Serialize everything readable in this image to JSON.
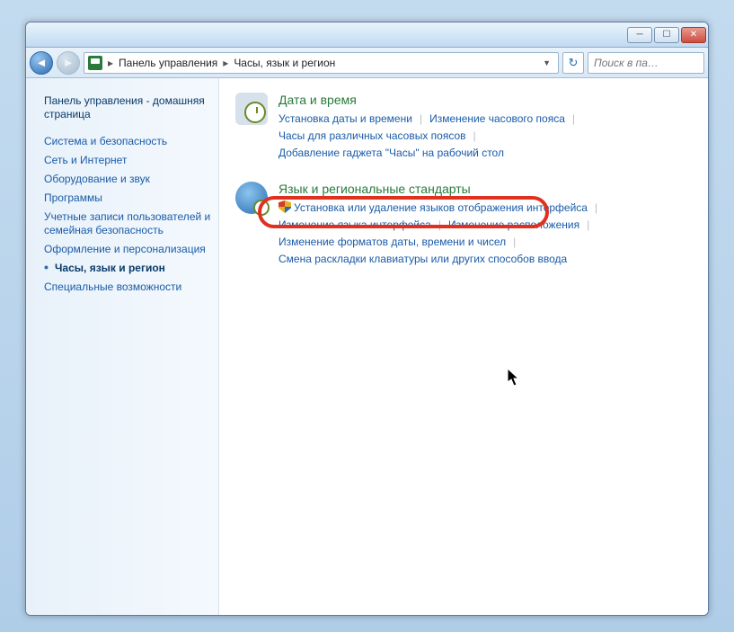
{
  "breadcrumb": {
    "root": "Панель управления",
    "current": "Часы, язык и регион"
  },
  "search": {
    "placeholder": "Поиск в па…"
  },
  "sidebar": {
    "home": "Панель управления - домашняя страница",
    "items": [
      "Система и безопасность",
      "Сеть и Интернет",
      "Оборудование и звук",
      "Программы",
      "Учетные записи пользователей и семейная безопасность",
      "Оформление и персонализация",
      "Часы, язык и регион",
      "Специальные возможности"
    ],
    "active_index": 6
  },
  "sections": [
    {
      "icon": "clock",
      "title": "Дата и время",
      "tasks": [
        "Установка даты и времени",
        "Изменение часового пояса",
        "Часы для различных часовых поясов",
        "Добавление гаджета \"Часы\" на рабочий стол"
      ]
    },
    {
      "icon": "globe",
      "title": "Язык и региональные стандарты",
      "tasks": [
        "Установка или удаление языков отображения интерфейса",
        "Изменение языка интерфейса",
        "Изменение расположения",
        "Изменение форматов даты, времени и чисел",
        "Смена раскладки клавиатуры или других способов ввода"
      ],
      "shield_task_index": 0
    }
  ]
}
